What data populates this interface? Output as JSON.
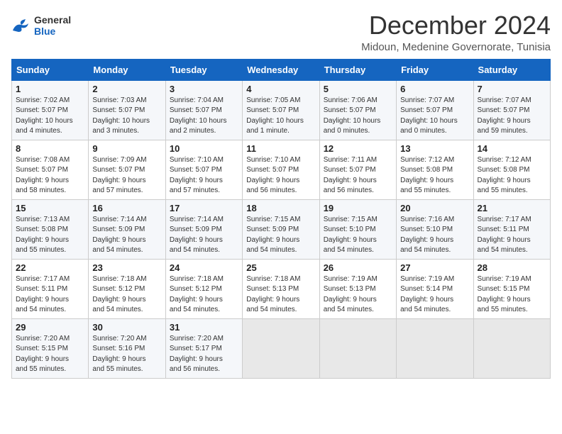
{
  "header": {
    "logo_general": "General",
    "logo_blue": "Blue",
    "month_title": "December 2024",
    "location": "Midoun, Medenine Governorate, Tunisia"
  },
  "weekdays": [
    "Sunday",
    "Monday",
    "Tuesday",
    "Wednesday",
    "Thursday",
    "Friday",
    "Saturday"
  ],
  "weeks": [
    [
      {
        "day": "1",
        "info": "Sunrise: 7:02 AM\nSunset: 5:07 PM\nDaylight: 10 hours\nand 4 minutes."
      },
      {
        "day": "2",
        "info": "Sunrise: 7:03 AM\nSunset: 5:07 PM\nDaylight: 10 hours\nand 3 minutes."
      },
      {
        "day": "3",
        "info": "Sunrise: 7:04 AM\nSunset: 5:07 PM\nDaylight: 10 hours\nand 2 minutes."
      },
      {
        "day": "4",
        "info": "Sunrise: 7:05 AM\nSunset: 5:07 PM\nDaylight: 10 hours\nand 1 minute."
      },
      {
        "day": "5",
        "info": "Sunrise: 7:06 AM\nSunset: 5:07 PM\nDaylight: 10 hours\nand 0 minutes."
      },
      {
        "day": "6",
        "info": "Sunrise: 7:07 AM\nSunset: 5:07 PM\nDaylight: 10 hours\nand 0 minutes."
      },
      {
        "day": "7",
        "info": "Sunrise: 7:07 AM\nSunset: 5:07 PM\nDaylight: 9 hours\nand 59 minutes."
      }
    ],
    [
      {
        "day": "8",
        "info": "Sunrise: 7:08 AM\nSunset: 5:07 PM\nDaylight: 9 hours\nand 58 minutes."
      },
      {
        "day": "9",
        "info": "Sunrise: 7:09 AM\nSunset: 5:07 PM\nDaylight: 9 hours\nand 57 minutes."
      },
      {
        "day": "10",
        "info": "Sunrise: 7:10 AM\nSunset: 5:07 PM\nDaylight: 9 hours\nand 57 minutes."
      },
      {
        "day": "11",
        "info": "Sunrise: 7:10 AM\nSunset: 5:07 PM\nDaylight: 9 hours\nand 56 minutes."
      },
      {
        "day": "12",
        "info": "Sunrise: 7:11 AM\nSunset: 5:07 PM\nDaylight: 9 hours\nand 56 minutes."
      },
      {
        "day": "13",
        "info": "Sunrise: 7:12 AM\nSunset: 5:08 PM\nDaylight: 9 hours\nand 55 minutes."
      },
      {
        "day": "14",
        "info": "Sunrise: 7:12 AM\nSunset: 5:08 PM\nDaylight: 9 hours\nand 55 minutes."
      }
    ],
    [
      {
        "day": "15",
        "info": "Sunrise: 7:13 AM\nSunset: 5:08 PM\nDaylight: 9 hours\nand 55 minutes."
      },
      {
        "day": "16",
        "info": "Sunrise: 7:14 AM\nSunset: 5:09 PM\nDaylight: 9 hours\nand 54 minutes."
      },
      {
        "day": "17",
        "info": "Sunrise: 7:14 AM\nSunset: 5:09 PM\nDaylight: 9 hours\nand 54 minutes."
      },
      {
        "day": "18",
        "info": "Sunrise: 7:15 AM\nSunset: 5:09 PM\nDaylight: 9 hours\nand 54 minutes."
      },
      {
        "day": "19",
        "info": "Sunrise: 7:15 AM\nSunset: 5:10 PM\nDaylight: 9 hours\nand 54 minutes."
      },
      {
        "day": "20",
        "info": "Sunrise: 7:16 AM\nSunset: 5:10 PM\nDaylight: 9 hours\nand 54 minutes."
      },
      {
        "day": "21",
        "info": "Sunrise: 7:17 AM\nSunset: 5:11 PM\nDaylight: 9 hours\nand 54 minutes."
      }
    ],
    [
      {
        "day": "22",
        "info": "Sunrise: 7:17 AM\nSunset: 5:11 PM\nDaylight: 9 hours\nand 54 minutes."
      },
      {
        "day": "23",
        "info": "Sunrise: 7:18 AM\nSunset: 5:12 PM\nDaylight: 9 hours\nand 54 minutes."
      },
      {
        "day": "24",
        "info": "Sunrise: 7:18 AM\nSunset: 5:12 PM\nDaylight: 9 hours\nand 54 minutes."
      },
      {
        "day": "25",
        "info": "Sunrise: 7:18 AM\nSunset: 5:13 PM\nDaylight: 9 hours\nand 54 minutes."
      },
      {
        "day": "26",
        "info": "Sunrise: 7:19 AM\nSunset: 5:13 PM\nDaylight: 9 hours\nand 54 minutes."
      },
      {
        "day": "27",
        "info": "Sunrise: 7:19 AM\nSunset: 5:14 PM\nDaylight: 9 hours\nand 54 minutes."
      },
      {
        "day": "28",
        "info": "Sunrise: 7:19 AM\nSunset: 5:15 PM\nDaylight: 9 hours\nand 55 minutes."
      }
    ],
    [
      {
        "day": "29",
        "info": "Sunrise: 7:20 AM\nSunset: 5:15 PM\nDaylight: 9 hours\nand 55 minutes."
      },
      {
        "day": "30",
        "info": "Sunrise: 7:20 AM\nSunset: 5:16 PM\nDaylight: 9 hours\nand 55 minutes."
      },
      {
        "day": "31",
        "info": "Sunrise: 7:20 AM\nSunset: 5:17 PM\nDaylight: 9 hours\nand 56 minutes."
      },
      {
        "day": "",
        "info": ""
      },
      {
        "day": "",
        "info": ""
      },
      {
        "day": "",
        "info": ""
      },
      {
        "day": "",
        "info": ""
      }
    ]
  ]
}
